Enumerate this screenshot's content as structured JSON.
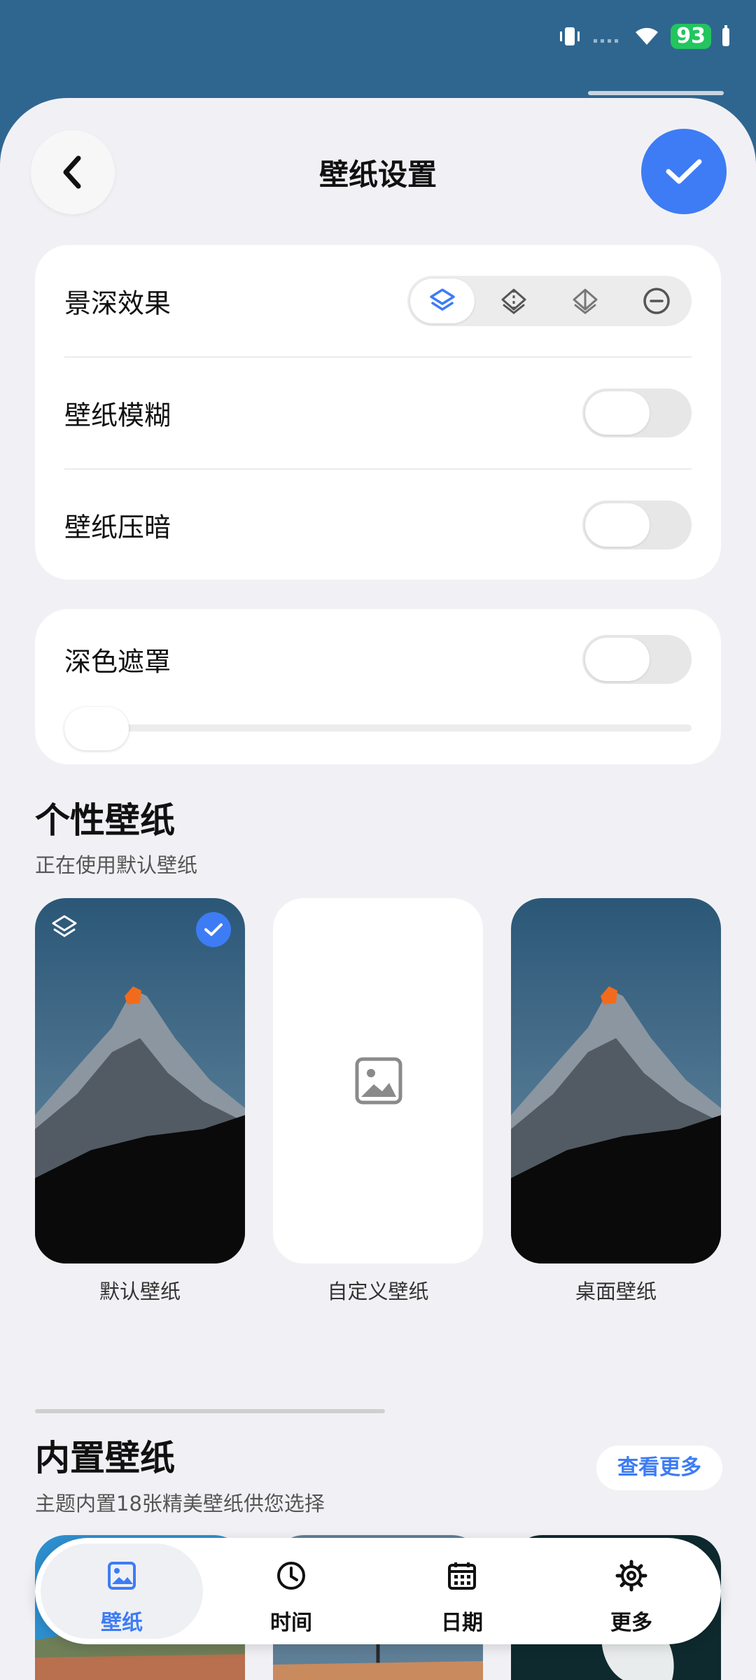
{
  "status_bar": {
    "battery": "93"
  },
  "header": {
    "title": "壁纸设置"
  },
  "settings": {
    "depth_label": "景深效果",
    "blur_label": "壁纸模糊",
    "dim_label": "壁纸压暗",
    "dark_mask_label": "深色遮罩",
    "dark_mask_level": 0,
    "toggles": {
      "blur": false,
      "dim": false,
      "dark_mask": false
    },
    "depth_options": [
      "layers-icon",
      "depth-dashed-icon",
      "depth-light-icon",
      "minus-circle-icon"
    ],
    "depth_selected": 0
  },
  "personal": {
    "title": "个性壁纸",
    "subtitle": "正在使用默认壁纸",
    "items": [
      {
        "caption": "默认壁纸",
        "selected": true
      },
      {
        "caption": "自定义壁纸",
        "selected": false
      },
      {
        "caption": "桌面壁纸",
        "selected": false
      }
    ]
  },
  "builtin": {
    "title": "内置壁纸",
    "subtitle": "主题内置18张精美壁纸供您选择",
    "more_label": "查看更多"
  },
  "nav": {
    "items": [
      {
        "label": "壁纸",
        "icon": "image-icon",
        "active": true
      },
      {
        "label": "时间",
        "icon": "clock-icon",
        "active": false
      },
      {
        "label": "日期",
        "icon": "calendar-icon",
        "active": false
      },
      {
        "label": "更多",
        "icon": "gear-icon",
        "active": false
      }
    ]
  },
  "colors": {
    "accent": "#3d7cf4",
    "header_bg": "#2f6690",
    "battery": "#22c55e"
  }
}
